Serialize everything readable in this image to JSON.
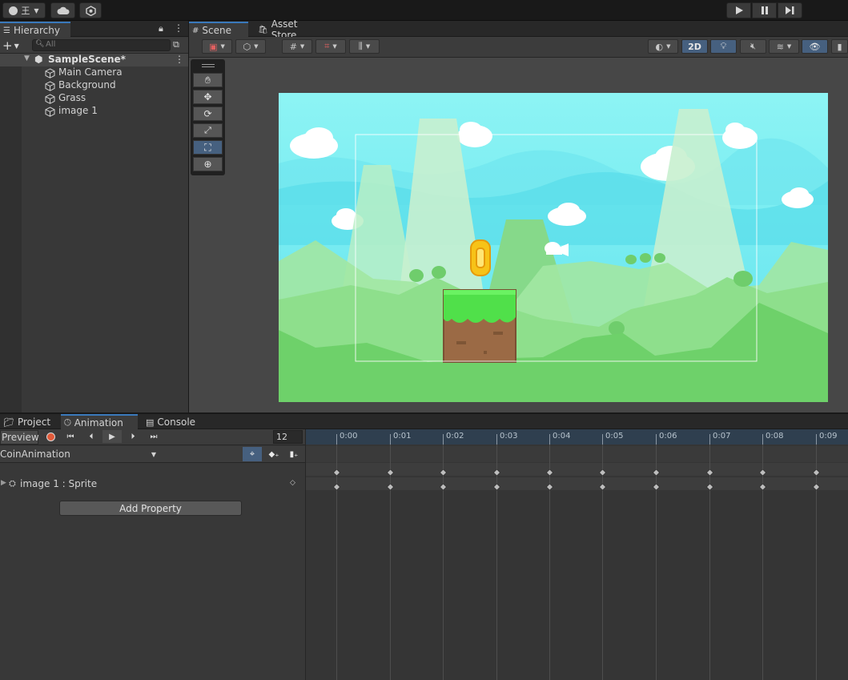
{
  "topbar": {
    "account_label": "王",
    "play_icons": [
      "play-icon",
      "pause-icon",
      "step-icon"
    ]
  },
  "hierarchy": {
    "tab_label": "Hierarchy",
    "search_placeholder": "All",
    "scene_name": "SampleScene*",
    "items": [
      {
        "label": "Main Camera"
      },
      {
        "label": "Background"
      },
      {
        "label": "Grass"
      },
      {
        "label": "image 1"
      }
    ]
  },
  "scene_view": {
    "tabs": [
      {
        "label": "Scene"
      },
      {
        "label": "Asset Store"
      }
    ],
    "mode_2d_label": "2D"
  },
  "bottom_tabs": [
    {
      "label": "Project"
    },
    {
      "label": "Animation"
    },
    {
      "label": "Console"
    }
  ],
  "animation": {
    "preview_label": "Preview",
    "frame_value": "12",
    "clip_name": "CoinAnimation",
    "property_label": "image 1 : Sprite",
    "add_property_label": "Add Property",
    "ruler_ticks": [
      "0:00",
      "0:01",
      "0:02",
      "0:03",
      "0:04",
      "0:05",
      "0:06",
      "0:07",
      "0:08",
      "0:09"
    ]
  },
  "colors": {
    "accent": "#3a79bb",
    "sky": "#7de8f0",
    "grass": "#6ed16a"
  }
}
